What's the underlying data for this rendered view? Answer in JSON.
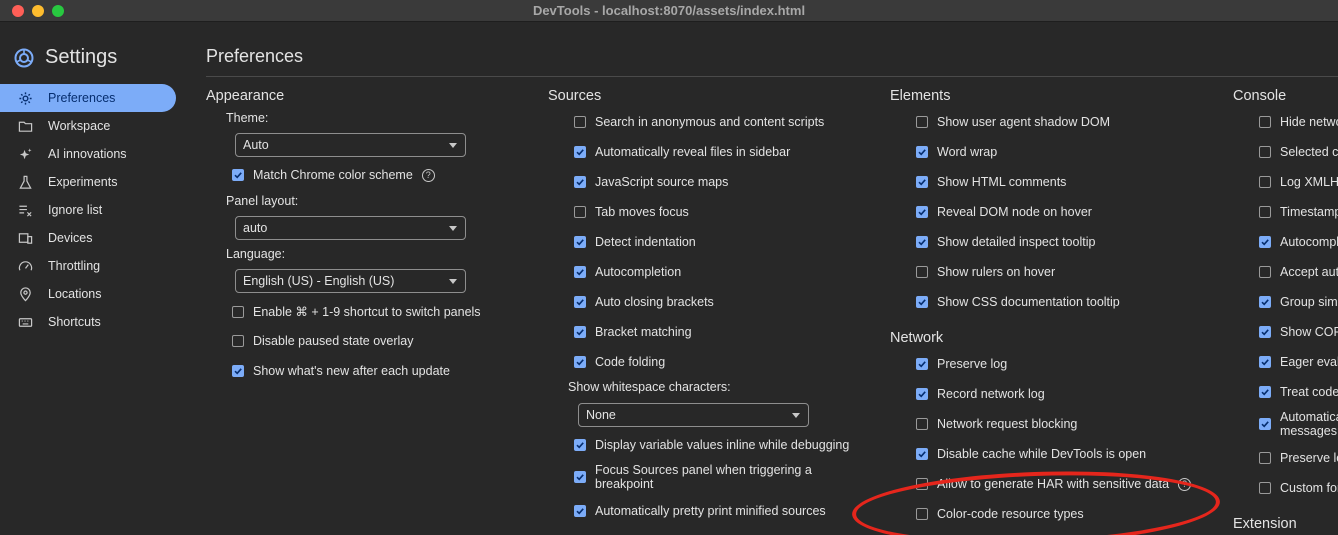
{
  "window": {
    "title": "DevTools - localhost:8070/assets/index.html"
  },
  "sidebar": {
    "title": "Settings",
    "items": [
      {
        "label": "Preferences",
        "icon": "gear-icon",
        "active": true
      },
      {
        "label": "Workspace",
        "icon": "folder-icon",
        "active": false
      },
      {
        "label": "AI innovations",
        "icon": "sparkle-icon",
        "active": false
      },
      {
        "label": "Experiments",
        "icon": "flask-icon",
        "active": false
      },
      {
        "label": "Ignore list",
        "icon": "list-x-icon",
        "active": false
      },
      {
        "label": "Devices",
        "icon": "devices-icon",
        "active": false
      },
      {
        "label": "Throttling",
        "icon": "gauge-icon",
        "active": false
      },
      {
        "label": "Locations",
        "icon": "pin-icon",
        "active": false
      },
      {
        "label": "Shortcuts",
        "icon": "keyboard-icon",
        "active": false
      }
    ]
  },
  "main": {
    "title": "Preferences"
  },
  "appearance": {
    "title": "Appearance",
    "theme_label": "Theme:",
    "theme_value": "Auto",
    "match_scheme": {
      "label": "Match Chrome color scheme",
      "checked": true
    },
    "panel_layout_label": "Panel layout:",
    "panel_layout_value": "auto",
    "language_label": "Language:",
    "language_value": "English (US) - English (US)",
    "options": [
      {
        "label": "Enable ⌘ + 1-9 shortcut to switch panels",
        "checked": false
      },
      {
        "label": "Disable paused state overlay",
        "checked": false
      },
      {
        "label": "Show what's new after each update",
        "checked": true
      }
    ]
  },
  "sources": {
    "title": "Sources",
    "options": [
      {
        "label": "Search in anonymous and content scripts",
        "checked": false
      },
      {
        "label": "Automatically reveal files in sidebar",
        "checked": true
      },
      {
        "label": "JavaScript source maps",
        "checked": true
      },
      {
        "label": "Tab moves focus",
        "checked": false
      },
      {
        "label": "Detect indentation",
        "checked": true
      },
      {
        "label": "Autocompletion",
        "checked": true
      },
      {
        "label": "Auto closing brackets",
        "checked": true
      },
      {
        "label": "Bracket matching",
        "checked": true
      },
      {
        "label": "Code folding",
        "checked": true
      }
    ],
    "whitespace_label": "Show whitespace characters:",
    "whitespace_value": "None",
    "more_options": [
      {
        "label": "Display variable values inline while debugging",
        "checked": true
      },
      {
        "label": "Focus Sources panel when triggering a breakpoint",
        "checked": true
      },
      {
        "label": "Automatically pretty print minified sources",
        "checked": true
      }
    ]
  },
  "elements": {
    "title": "Elements",
    "options": [
      {
        "label": "Show user agent shadow DOM",
        "checked": false
      },
      {
        "label": "Word wrap",
        "checked": true
      },
      {
        "label": "Show HTML comments",
        "checked": true
      },
      {
        "label": "Reveal DOM node on hover",
        "checked": true
      },
      {
        "label": "Show detailed inspect tooltip",
        "checked": true
      },
      {
        "label": "Show rulers on hover",
        "checked": false
      },
      {
        "label": "Show CSS documentation tooltip",
        "checked": true
      }
    ]
  },
  "network": {
    "title": "Network",
    "options": [
      {
        "label": "Preserve log",
        "checked": true
      },
      {
        "label": "Record network log",
        "checked": true
      },
      {
        "label": "Network request blocking",
        "checked": false
      },
      {
        "label": "Disable cache while DevTools is open",
        "checked": true
      },
      {
        "label": "Allow to generate HAR with sensitive data",
        "checked": false
      },
      {
        "label": "Color-code resource types",
        "checked": false
      }
    ]
  },
  "console": {
    "title": "Console",
    "options": [
      {
        "label": "Hide netwo",
        "checked": false
      },
      {
        "label": "Selected co",
        "checked": false
      },
      {
        "label": "Log XMLHt",
        "checked": false
      },
      {
        "label": "Timestamp",
        "checked": false
      },
      {
        "label": "Autocompl",
        "checked": true
      },
      {
        "label": "Accept aut",
        "checked": false
      },
      {
        "label": "Group simi",
        "checked": true
      },
      {
        "label": "Show COR",
        "checked": true
      },
      {
        "label": "Eager evalu",
        "checked": true
      },
      {
        "label": "Treat code",
        "checked": true
      },
      {
        "label": "Automatica messages",
        "checked": true
      },
      {
        "label": "Preserve lo",
        "checked": false
      },
      {
        "label": "Custom for",
        "checked": false
      }
    ]
  },
  "extension": {
    "title": "Extension"
  },
  "colors": {
    "accent": "#7cacf8",
    "annotation": "#e5261c"
  }
}
